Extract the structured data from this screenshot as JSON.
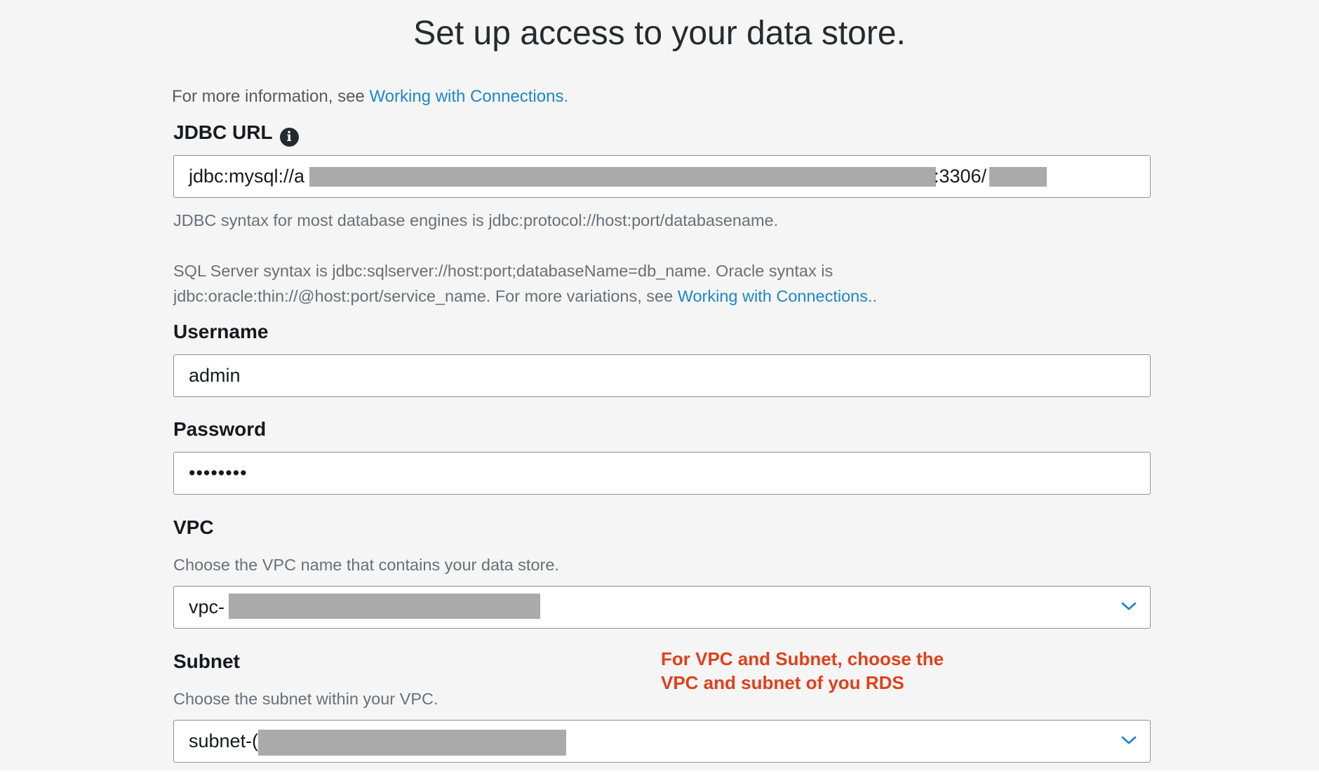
{
  "header": {
    "title": "Set up access to your data store."
  },
  "intro": {
    "text": "For more information, see ",
    "link": "Working with Connections."
  },
  "jdbc": {
    "label": "JDBC URL",
    "info_icon": "info-icon",
    "value_prefix": "jdbc:mysql://a",
    "value_port": ":3306/",
    "hint1": "JDBC syntax for most database engines is jdbc:protocol://host:port/databasename.",
    "hint2_line1": "SQL Server syntax is jdbc:sqlserver://host:port;databaseName=db_name. Oracle syntax is",
    "hint2_line2": "jdbc:oracle:thin://@host:port/service_name. For more variations, see ",
    "hint2_link": "Working with Connections.",
    "hint2_suffix": "."
  },
  "username": {
    "label": "Username",
    "value": "admin"
  },
  "password": {
    "label": "Password",
    "value": "••••••••"
  },
  "vpc": {
    "label": "VPC",
    "hint": "Choose the VPC name that contains your data store.",
    "value": "vpc-"
  },
  "subnet": {
    "label": "Subnet",
    "hint": "Choose the subnet within your VPC.",
    "value": "subnet-("
  },
  "annotation": {
    "line1": "For VPC and Subnet, choose the",
    "line2": "VPC and subnet of you RDS",
    "color": "#e0401c"
  },
  "colors": {
    "link": "#1f86c8",
    "background": "#f4f5f4",
    "redaction": "#aaaaaa"
  }
}
